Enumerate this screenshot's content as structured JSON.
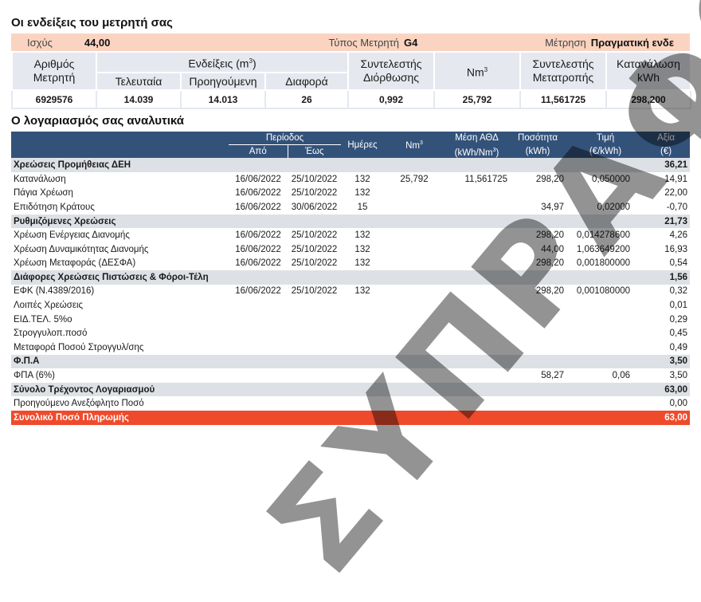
{
  "meter_section": {
    "title": "Οι ενδείξεις του μετρητή σας",
    "power_label": "Ισχύς",
    "power_value": "44,00",
    "meter_type_label": "Τύπος Μετρητή",
    "meter_type_value": "G4",
    "measurement_label": "Μέτρηση",
    "measurement_value": "Πραγματική ενδε",
    "headers": {
      "meter_number_1": "Αριθμός",
      "meter_number_2": "Μετρητή",
      "readings": "Ενδείξεις (m",
      "readings_sup": "3",
      "readings_close": ")",
      "last": "Τελευταία",
      "previous": "Προηγούμενη",
      "difference": "Διαφορά",
      "correction_1": "Συντελεστής",
      "correction_2": "Διόρθωσης",
      "nm": "Nm",
      "nm_sup": "3",
      "conversion_1": "Συντελεστής",
      "conversion_2": "Μετατροπής",
      "consumption_1": "Κατανάλωση",
      "consumption_2": "kWh"
    },
    "row": {
      "meter_number": "6929576",
      "last": "14.039",
      "previous": "14.013",
      "difference": "26",
      "correction": "0,992",
      "nm": "25,792",
      "conversion": "11,561725",
      "consumption": "298,200"
    }
  },
  "bill_section": {
    "title": "Ο λογαριασμός σας αναλυτικά",
    "headers": {
      "period": "Περίοδος",
      "from": "Από",
      "to": "Έως",
      "days": "Ημέρες",
      "nm": "Nm",
      "nm_sup": "3",
      "avg_1": "Μέση ΑΘΔ",
      "avg_2": "(kWh/Nm",
      "avg_sup": "3",
      "avg_close": ")",
      "qty_1": "Ποσότητα",
      "qty_2": "(kWh)",
      "price_1": "Τιμή",
      "price_2": "(€/kWh)",
      "value_1": "Αξία",
      "value_2": "(€)"
    },
    "rows": [
      {
        "type": "grp",
        "desc": "Χρεώσεις Προμήθειας ΔΕΗ",
        "from": "",
        "to": "",
        "days": "",
        "nm": "",
        "avg": "",
        "qty": "",
        "price": "",
        "value": "36,21"
      },
      {
        "type": "item",
        "desc": "Κατανάλωση",
        "from": "16/06/2022",
        "to": "25/10/2022",
        "days": "132",
        "nm": "25,792",
        "avg": "11,561725",
        "qty": "298,20",
        "price": "0,050000",
        "value": "14,91"
      },
      {
        "type": "item",
        "desc": "Πάγια Χρέωση",
        "from": "16/06/2022",
        "to": "25/10/2022",
        "days": "132",
        "nm": "",
        "avg": "",
        "qty": "",
        "price": "",
        "value": "22,00"
      },
      {
        "type": "item",
        "desc": "Επιδότηση Κράτους",
        "from": "16/06/2022",
        "to": "30/06/2022",
        "days": "15",
        "nm": "",
        "avg": "",
        "qty": "34,97",
        "price": "0,02000",
        "value": "-0,70"
      },
      {
        "type": "grp",
        "desc": "Ρυθμιζόμενες Χρεώσεις",
        "from": "",
        "to": "",
        "days": "",
        "nm": "",
        "avg": "",
        "qty": "",
        "price": "",
        "value": "21,73"
      },
      {
        "type": "item",
        "desc": "Χρέωση Ενέργειας Διανομής",
        "from": "16/06/2022",
        "to": "25/10/2022",
        "days": "132",
        "nm": "",
        "avg": "",
        "qty": "298,20",
        "price": "0,014278600",
        "value": "4,26"
      },
      {
        "type": "item",
        "desc": "Χρέωση Δυναμικότητας Διανομής",
        "from": "16/06/2022",
        "to": "25/10/2022",
        "days": "132",
        "nm": "",
        "avg": "",
        "qty": "44,00",
        "price": "1,063649200",
        "value": "16,93"
      },
      {
        "type": "item",
        "desc": "Χρέωση Μεταφοράς (ΔΕΣΦΑ)",
        "from": "16/06/2022",
        "to": "25/10/2022",
        "days": "132",
        "nm": "",
        "avg": "",
        "qty": "298,20",
        "price": "0,001800000",
        "value": "0,54"
      },
      {
        "type": "grp",
        "desc": "Διάφορες Χρεώσεις Πιστώσεις & Φόροι-Τέλη",
        "from": "",
        "to": "",
        "days": "",
        "nm": "",
        "avg": "",
        "qty": "",
        "price": "",
        "value": "1,56"
      },
      {
        "type": "item",
        "desc": "ΕΦΚ (Ν.4389/2016)",
        "from": "16/06/2022",
        "to": "25/10/2022",
        "days": "132",
        "nm": "",
        "avg": "",
        "qty": "298,20",
        "price": "0,001080000",
        "value": "0,32"
      },
      {
        "type": "item",
        "desc": "Λοιπές Χρεώσεις",
        "from": "",
        "to": "",
        "days": "",
        "nm": "",
        "avg": "",
        "qty": "",
        "price": "",
        "value": "0,01"
      },
      {
        "type": "item",
        "desc": "ΕΙΔ.ΤΕΛ. 5%ο",
        "from": "",
        "to": "",
        "days": "",
        "nm": "",
        "avg": "",
        "qty": "",
        "price": "",
        "value": "0,29"
      },
      {
        "type": "item",
        "desc": "Στρογγυλοπ.ποσό",
        "from": "",
        "to": "",
        "days": "",
        "nm": "",
        "avg": "",
        "qty": "",
        "price": "",
        "value": "0,45"
      },
      {
        "type": "item",
        "desc": "Μεταφορά Ποσού Στρογγυλ/σης",
        "from": "",
        "to": "",
        "days": "",
        "nm": "",
        "avg": "",
        "qty": "",
        "price": "",
        "value": "0,49"
      },
      {
        "type": "grp",
        "desc": "Φ.Π.Α",
        "from": "",
        "to": "",
        "days": "",
        "nm": "",
        "avg": "",
        "qty": "",
        "price": "",
        "value": "3,50"
      },
      {
        "type": "item",
        "desc": "ΦΠΑ (6%)",
        "from": "",
        "to": "",
        "days": "",
        "nm": "",
        "avg": "",
        "qty": "58,27",
        "price": "0,06",
        "value": "3,50"
      },
      {
        "type": "grp",
        "desc": "Σύνολο Τρέχοντος Λογαριασμού",
        "from": "",
        "to": "",
        "days": "",
        "nm": "",
        "avg": "",
        "qty": "",
        "price": "",
        "value": "63,00"
      },
      {
        "type": "item",
        "desc": "Προηγούμενο Ανεξόφλητο Ποσό",
        "from": "",
        "to": "",
        "days": "",
        "nm": "",
        "avg": "",
        "qty": "",
        "price": "",
        "value": "0,00"
      },
      {
        "type": "total",
        "desc": "Συνολικό Ποσό Πληρωμής",
        "from": "",
        "to": "",
        "days": "",
        "nm": "",
        "avg": "",
        "qty": "",
        "price": "",
        "value": "63,00"
      }
    ]
  },
  "watermark": "ΣΥΠΡΑΦΟ"
}
